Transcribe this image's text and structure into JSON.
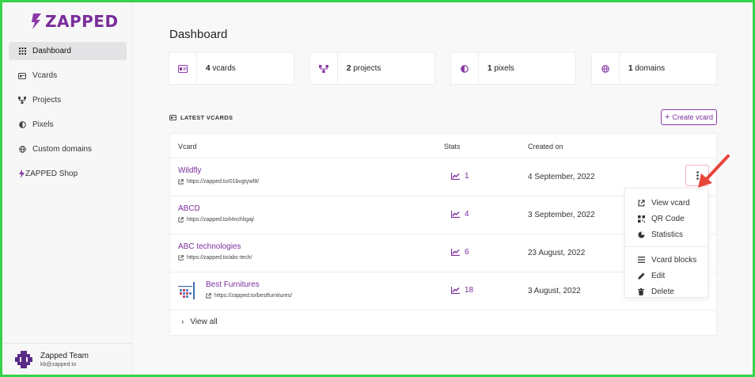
{
  "brand": {
    "name": "ZAPPED",
    "color": "#7b2d9b"
  },
  "sidebar": {
    "items": [
      {
        "label": "Dashboard",
        "icon": "grid-icon",
        "active": true
      },
      {
        "label": "Vcards",
        "icon": "id-card-icon"
      },
      {
        "label": "Projects",
        "icon": "sitemap-icon"
      },
      {
        "label": "Pixels",
        "icon": "half-circle-icon"
      },
      {
        "label": "Custom domains",
        "icon": "globe-icon"
      },
      {
        "label": "ZAPPED Shop",
        "icon": "bolt-icon"
      }
    ],
    "user": {
      "name": "Zapped Team",
      "email": "kb@zapped.to"
    }
  },
  "main": {
    "title": "Dashboard",
    "stats": [
      {
        "count": "4",
        "label": "vcards",
        "icon": "id-card-icon"
      },
      {
        "count": "2",
        "label": "projects",
        "icon": "sitemap-icon"
      },
      {
        "count": "1",
        "label": "pixels",
        "icon": "half-circle-icon"
      },
      {
        "count": "1",
        "label": "domains",
        "icon": "globe-icon"
      }
    ],
    "section_title": "LATEST VCARDS",
    "create_label": "Create vcard",
    "table": {
      "columns": [
        "Vcard",
        "Stats",
        "Created on"
      ],
      "rows": [
        {
          "name": "Wildfly",
          "url": "https://zapped.to/01bvgtywf8/",
          "stats": "1",
          "created": "4 September, 2022"
        },
        {
          "name": "ABCD",
          "url": "https://zapped.to/t4nchligaj/",
          "stats": "4",
          "created": "3 September, 2022"
        },
        {
          "name": "ABC technologies",
          "url": "https://zapped.to/abc-tech/",
          "stats": "6",
          "created": "23 August, 2022"
        },
        {
          "name": "Best Furnitures",
          "url": "https://zapped.to/bestfurnitures/",
          "stats": "18",
          "created": "3 August, 2022"
        }
      ]
    },
    "view_all": "View all"
  },
  "dropdown": {
    "items": [
      {
        "label": "View vcard",
        "icon": "external-link-icon"
      },
      {
        "label": "QR Code",
        "icon": "qr-code-icon"
      },
      {
        "label": "Statistics",
        "icon": "pie-chart-icon"
      },
      {
        "label": "Vcard blocks",
        "icon": "bars-icon"
      },
      {
        "label": "Edit",
        "icon": "pencil-icon"
      },
      {
        "label": "Delete",
        "icon": "trash-icon"
      }
    ]
  },
  "colors": {
    "accent": "#7b2d9b",
    "arrow": "#e8453c",
    "frame": "#35d24a"
  }
}
